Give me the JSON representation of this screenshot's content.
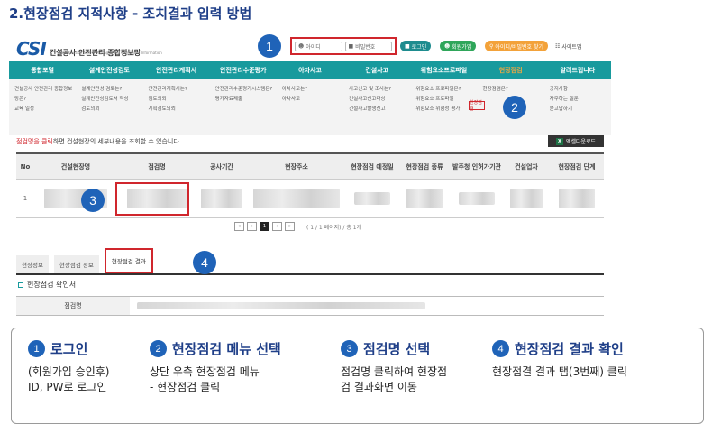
{
  "title": "2.현장점검 지적사항 - 조치결과 입력 방법",
  "site": {
    "logo_mark": "CSI",
    "logo_text": "건설공사 안전관리 종합정보망",
    "logo_sub": "Construction Safety Management Integrated Information",
    "id_placeholder": "아이디",
    "pw_placeholder": "비밀번호",
    "login_button": "로그인",
    "join_button": "회원가입",
    "find_button": "아이디/비밀번호 찾기",
    "sitemap": "사이트맵",
    "nav": [
      "통합포털",
      "설계안전성검토",
      "안전관리계획서",
      "안전관리수준평가",
      "아차사고",
      "건설사고",
      "위험요소프로파일",
      "현장점검",
      "알려드립니다"
    ],
    "active_nav_index": 7,
    "submenu": [
      [
        "건설공사 안전관리 종합정보망은?",
        "교육 일정"
      ],
      [
        "설계안전성 검토는?",
        "설계안전성검토서 작성",
        "검토의뢰"
      ],
      [
        "안전관리계획서는?",
        "검토의뢰",
        "계획검토의뢰"
      ],
      [
        "안전관리수준평가시스템은?",
        "평가자료제출"
      ],
      [
        "아차사고는?",
        "아차사고"
      ],
      [
        "사고신고 및 조사는?",
        "건설사고신고대상",
        "건설사고발생신고"
      ],
      [
        "위험요소 프로파일은?",
        "위험요소 프로파일",
        "위험요소 위험성 평가"
      ],
      [
        "현장점검은?",
        "현장점검"
      ],
      [
        "공지사항",
        "자주하는 질문",
        "묻고답하기"
      ]
    ],
    "info_highlight": "점검명을 클릭",
    "info_rest": "하면 건설현장의 세부내용을 조회할 수 있습니다.",
    "excel_button": "엑셀다운로드",
    "table_headers": [
      "No",
      "건설현장명",
      "점검명",
      "공사기간",
      "현장주소",
      "현장점검 예정일",
      "현장점검 종류",
      "발주청 인허가기관",
      "건설업자",
      "현장점검 단계"
    ],
    "row_no": "1",
    "pager_text": "( 1 / 1 페이지) / 총 1개",
    "pager_current": "1",
    "tabs": [
      "현장정보",
      "현장점검 정보",
      "현장점검 결과"
    ],
    "confirm_title": "현장점검 확인서",
    "confirm_label": "점검명",
    "callouts": [
      "1",
      "2",
      "3",
      "4"
    ]
  },
  "steps": [
    {
      "num": "1",
      "title": "로그인",
      "desc": [
        "(회원가입 승인후)",
        "ID, PW로 로그인"
      ]
    },
    {
      "num": "2",
      "title": "현장점검 메뉴 선택",
      "desc": [
        "상단 우측 현장점검 메뉴",
        "- 현장점검 클릭"
      ]
    },
    {
      "num": "3",
      "title": "점검명 선택",
      "desc": [
        "점검명 클릭하여 현장점",
        "검 결과화면 이동"
      ]
    },
    {
      "num": "4",
      "title": "현장점검 결과 확인",
      "desc": [
        "현장점결 결과 탭(3번째) 클릭"
      ]
    }
  ],
  "colors": {
    "primary": "#1f3f88",
    "nav": "#189a9d",
    "highlight": "#d0262d",
    "badge": "#1f63b8"
  }
}
